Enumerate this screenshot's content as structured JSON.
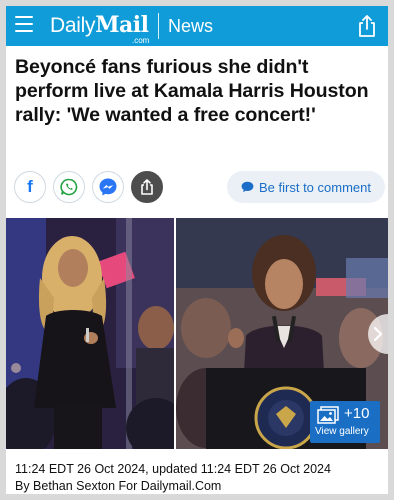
{
  "header": {
    "logo_daily": "Daily",
    "logo_mail": "Mail",
    "logo_com": ".com",
    "section": "News",
    "background_color": "#0f9cd8"
  },
  "article": {
    "headline": "Beyoncé fans furious she didn't perform live at Kamala Harris Houston rally: 'We wanted a free concert!'",
    "comment_button": "Be first to comment",
    "share_buttons": [
      "facebook-icon",
      "whatsapp-icon",
      "messenger-icon",
      "share-icon"
    ],
    "gallery": {
      "count": "+10",
      "label": "View gallery"
    },
    "dateline": "11:24 EDT 26 Oct 2024, updated 11:24 EDT 26 Oct 2024",
    "byline": "By Bethan Sexton For Dailymail.Com"
  },
  "colors": {
    "accent": "#0f9cd8",
    "link": "#1a6ec7",
    "gallery": "#1a6fc4"
  }
}
